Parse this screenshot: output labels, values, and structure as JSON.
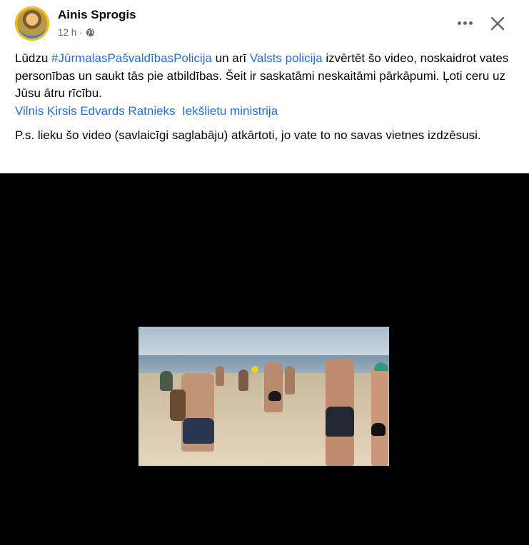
{
  "post": {
    "author": "Ainis Sprogis",
    "time": "12 h",
    "separator": "·",
    "privacy_icon": "globe-icon",
    "more_icon": "more-dots-icon",
    "close_icon": "close-icon"
  },
  "text": {
    "p1_a": "Lūdzu ",
    "hashtag": "#JūrmalasPašvaldībasPolicija",
    "p1_b": " un arī ",
    "mention_police": "Valsts policija",
    "p1_c": " izvērtēt šo video, noskaidrot vates personības un saukt tās pie atbildības. Šeit ir saskatāmi neskaitāmi pārkāpumi. Ļoti ceru uz Jūsu ātru rīcību.",
    "mention_1": "Vilnis Ķirsis",
    "mention_2": "Edvards Ratnieks",
    "mention_3": "Iekšlietu ministrija",
    "p2": "P.s. lieku šo video (savlaicīgi saglabāju) atkārtoti, jo vate to no savas vietnes izdzēsusi."
  },
  "colors": {
    "link": "#216fdb",
    "meta": "#65676b",
    "video_bg": "#000000"
  }
}
